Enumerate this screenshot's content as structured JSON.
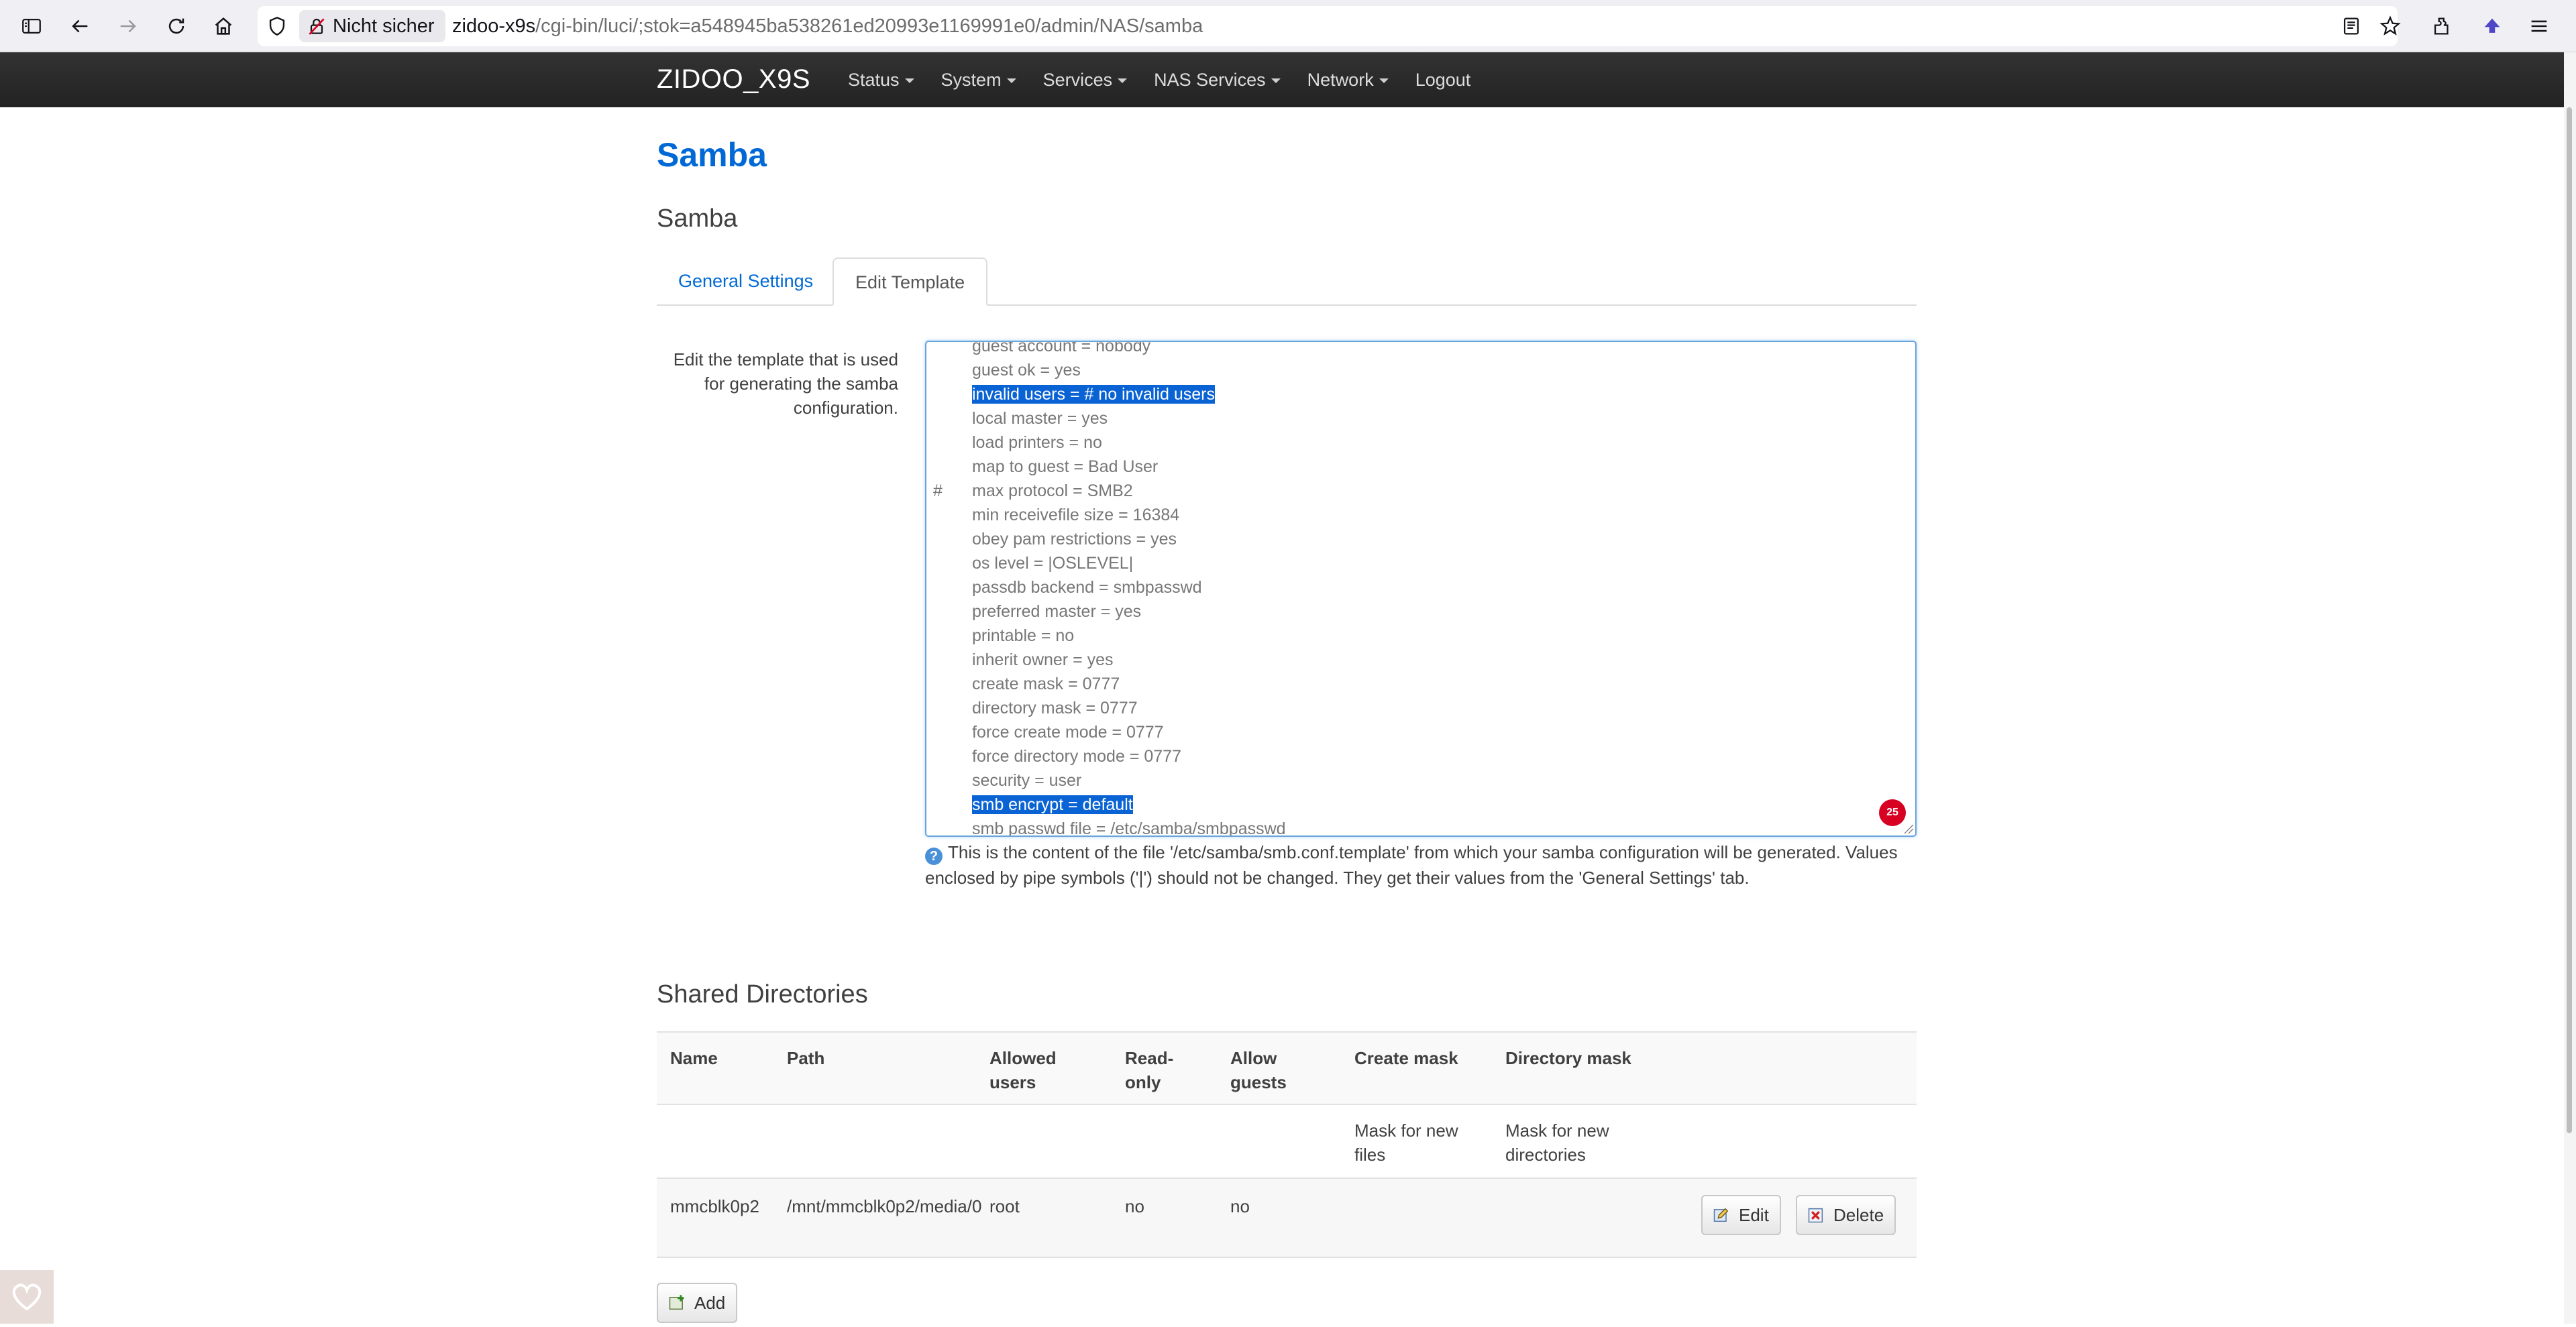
{
  "browser": {
    "security_label": "Nicht sicher",
    "url_host": "zidoo-x9s",
    "url_path": "/cgi-bin/luci/;stok=a548945ba538261ed20993e1169991e0/admin/NAS/samba"
  },
  "header": {
    "brand": "ZIDOO_X9S",
    "menu": [
      {
        "label": "Status"
      },
      {
        "label": "System"
      },
      {
        "label": "Services"
      },
      {
        "label": "NAS Services"
      },
      {
        "label": "Network"
      },
      {
        "label": "Logout"
      }
    ]
  },
  "page": {
    "title": "Samba",
    "section_title": "Samba",
    "tabs": [
      {
        "label": "General Settings"
      },
      {
        "label": "Edit Template"
      }
    ],
    "template_label": "Edit the template that is used for generating the samba configuration.",
    "help_text": "This is the content of the file '/etc/samba/smb.conf.template' from which your samba configuration will be generated. Values enclosed by pipe symbols ('|') should not be changed. They get their values from the 'General Settings' tab.",
    "spell_badge": "25"
  },
  "template_lines": [
    {
      "prefix": "",
      "text": "guest account = nobody"
    },
    {
      "prefix": "",
      "text": "guest ok = yes"
    },
    {
      "prefix": "",
      "text": "invalid users = # no invalid users"
    },
    {
      "prefix": "",
      "text": "local master = yes"
    },
    {
      "prefix": "",
      "text": "load printers = no"
    },
    {
      "prefix": "",
      "text": "map to guest = Bad User"
    },
    {
      "prefix": "#",
      "text": "max protocol = SMB2"
    },
    {
      "prefix": "",
      "text": "min receivefile size = 16384"
    },
    {
      "prefix": "",
      "text": "obey pam restrictions = yes"
    },
    {
      "prefix": "",
      "text": "os level = |OSLEVEL|"
    },
    {
      "prefix": "",
      "text": "passdb backend = smbpasswd"
    },
    {
      "prefix": "",
      "text": "preferred master = yes"
    },
    {
      "prefix": "",
      "text": "printable = no"
    },
    {
      "prefix": "",
      "text": "inherit owner = yes"
    },
    {
      "prefix": "",
      "text": "create mask = 0777"
    },
    {
      "prefix": "",
      "text": "directory mask = 0777"
    },
    {
      "prefix": "",
      "text": "force create mode = 0777"
    },
    {
      "prefix": "",
      "text": "force directory mode = 0777"
    },
    {
      "prefix": "",
      "text": "security = user"
    },
    {
      "prefix": "",
      "text": "smb encrypt = default"
    },
    {
      "prefix": "",
      "text": "smb passwd file = /etc/samba/smbpasswd"
    }
  ],
  "shares": {
    "title": "Shared Directories",
    "columns": {
      "name": "Name",
      "path": "Path",
      "allowed_users": "Allowed users",
      "read_only": "Read-only",
      "allow_guests": "Allow guests",
      "create_mask": "Create mask",
      "directory_mask": "Directory mask"
    },
    "descriptions": {
      "create_mask": "Mask for new files",
      "directory_mask": "Mask for new directories"
    },
    "rows": [
      {
        "name": "mmcblk0p2",
        "path": "/mnt/mmcblk0p2/media/0",
        "allowed_users": "root",
        "read_only": "no",
        "allow_guests": "no",
        "create_mask": "",
        "directory_mask": ""
      }
    ],
    "edit_label": "Edit",
    "delete_label": "Delete",
    "add_label": "Add"
  }
}
